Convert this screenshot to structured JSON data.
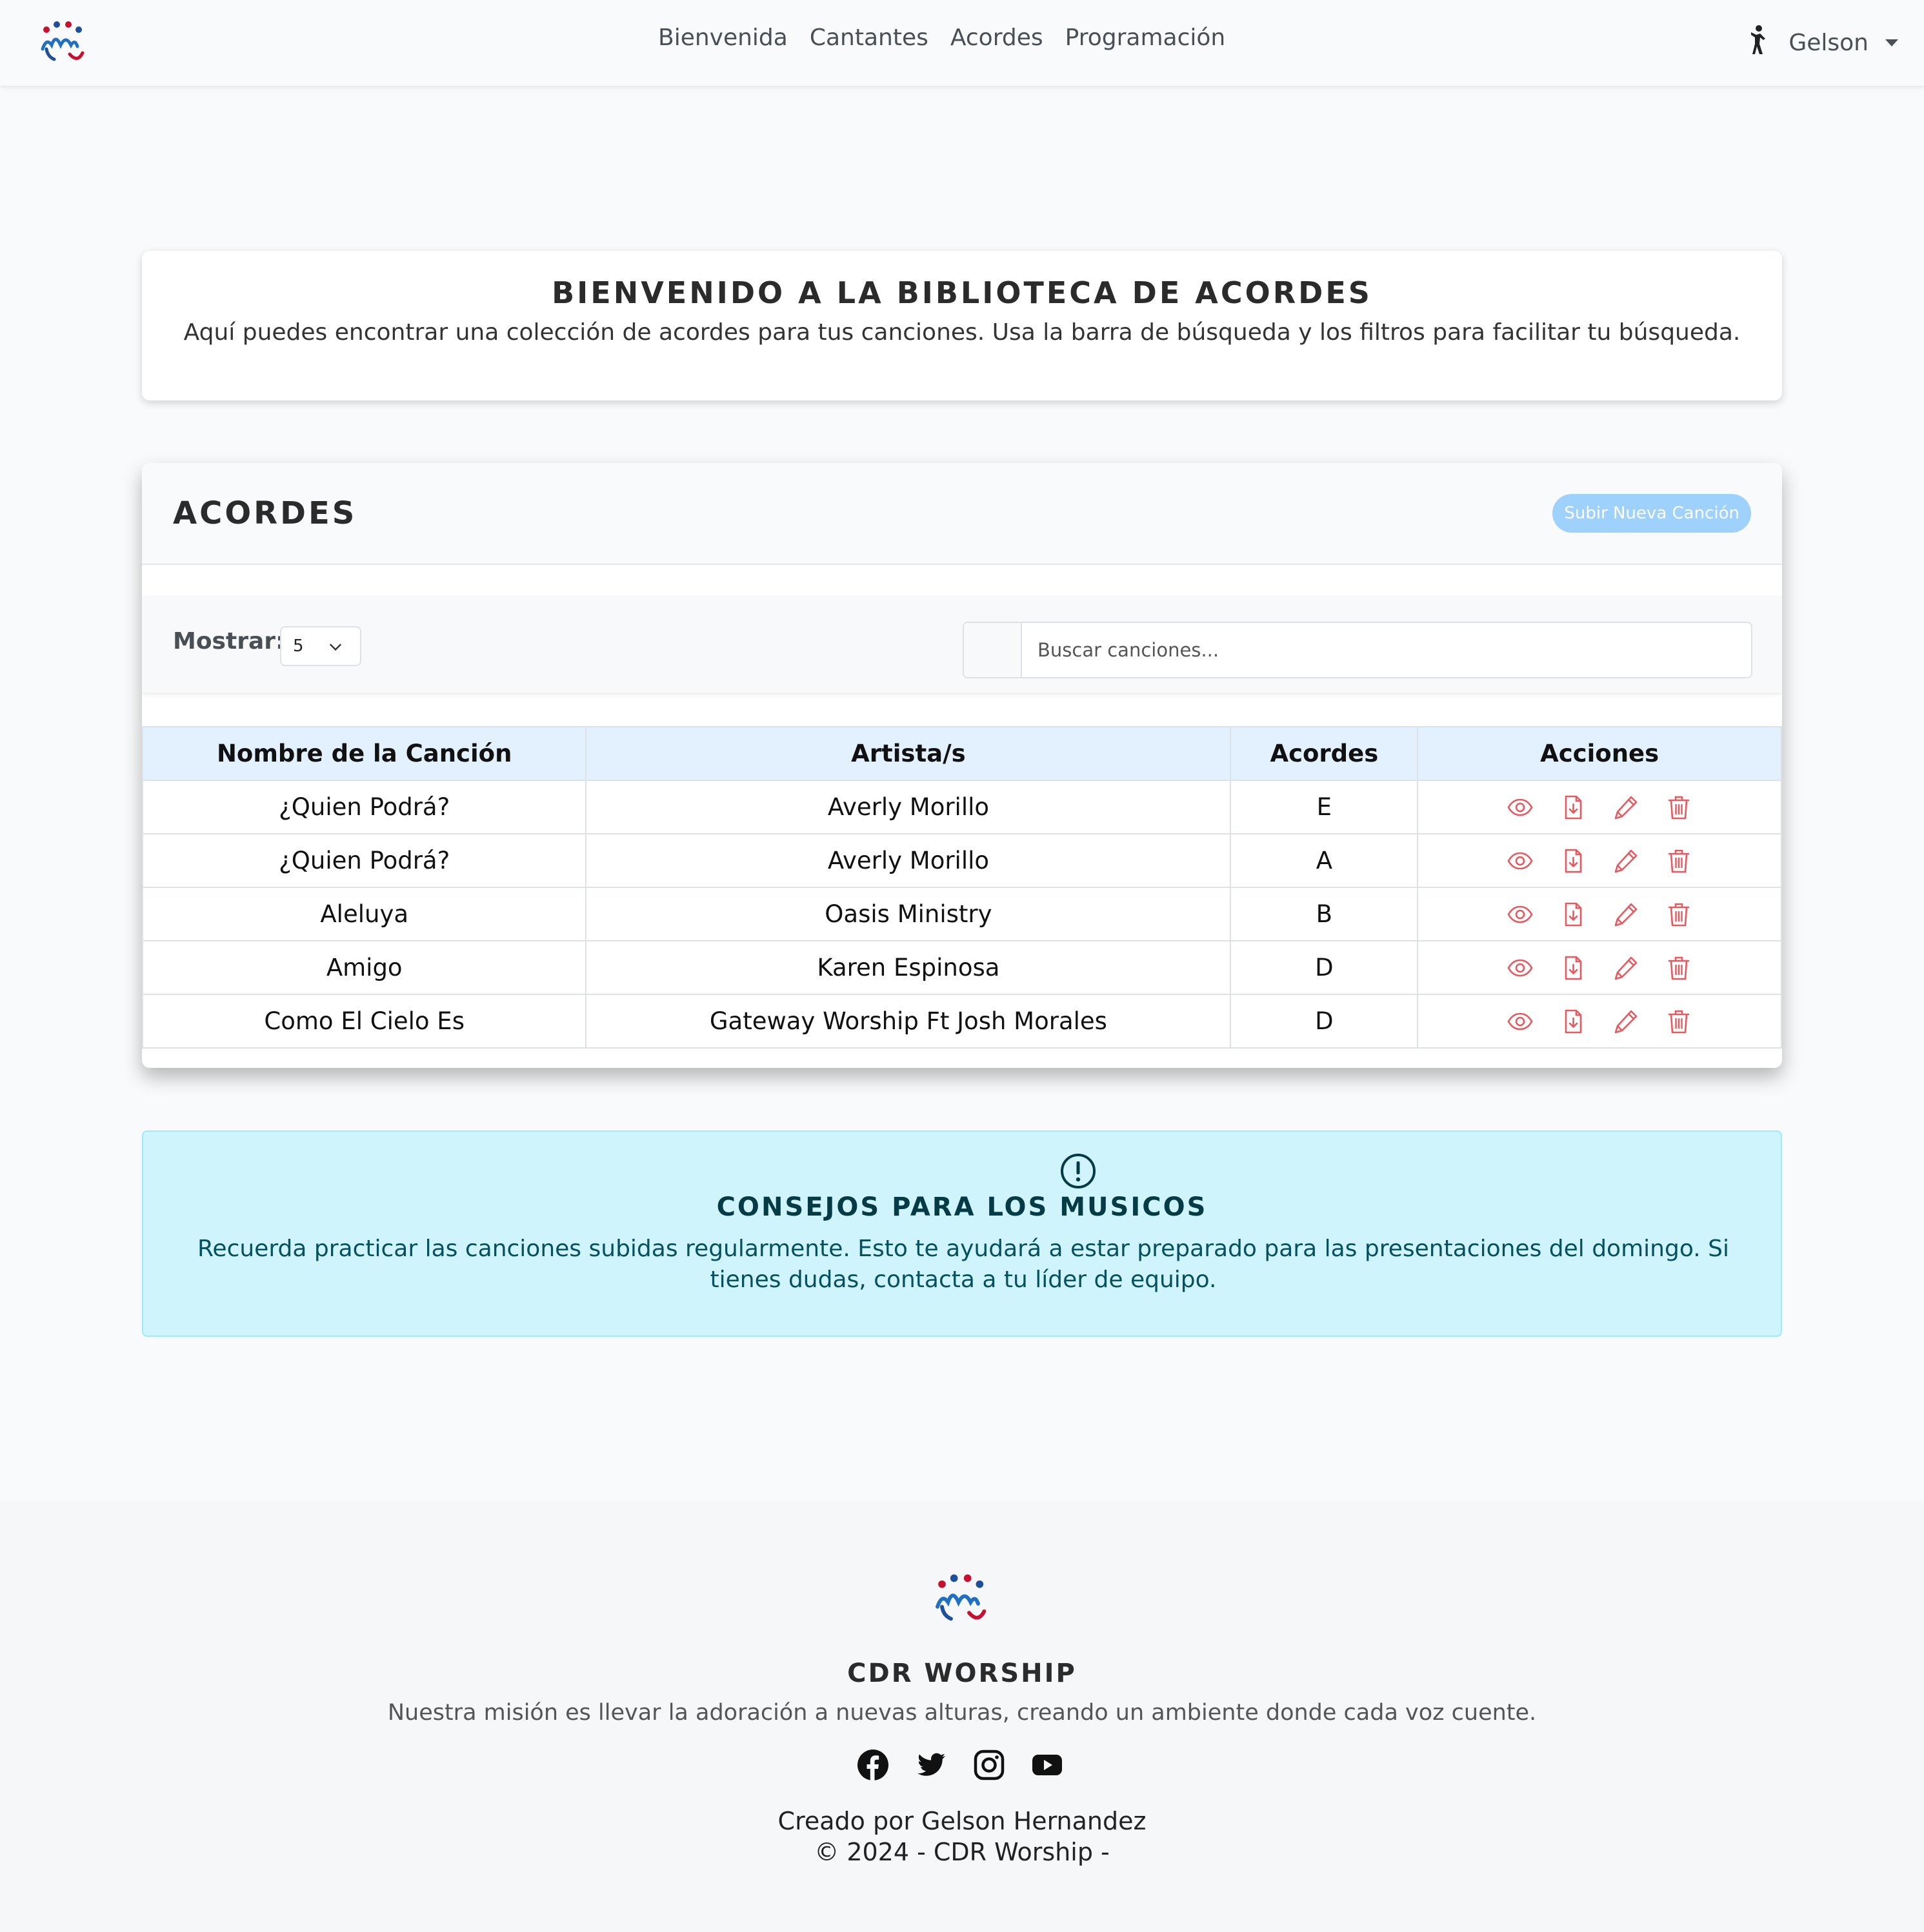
{
  "nav": {
    "links": [
      "Bienvenida",
      "Cantantes",
      "Acordes",
      "Programación"
    ],
    "user": "Gelson"
  },
  "welcome": {
    "title": "BIENVENIDO A LA BIBLIOTECA DE ACORDES",
    "text": "Aquí puedes encontrar una colección de acordes para tus canciones. Usa la barra de búsqueda y los filtros para facilitar tu búsqueda."
  },
  "chords": {
    "title": "ACORDES",
    "upload_label": "Subir Nueva Canción",
    "show_label": "Mostrar:",
    "show_value": "5",
    "search_placeholder": "Buscar canciones...",
    "columns": [
      "Nombre de la Canción",
      "Artista/s",
      "Acordes",
      "Acciones"
    ],
    "rows": [
      {
        "name": "¿Quien Podrá?",
        "artist": "Averly Morillo",
        "chord": "E"
      },
      {
        "name": "¿Quien Podrá?",
        "artist": "Averly Morillo",
        "chord": "A"
      },
      {
        "name": "Aleluya",
        "artist": "Oasis Ministry",
        "chord": "B"
      },
      {
        "name": "Amigo",
        "artist": "Karen Espinosa",
        "chord": "D"
      },
      {
        "name": "Como El Cielo Es",
        "artist": "Gateway Worship Ft Josh Morales",
        "chord": "D"
      }
    ],
    "action_icons": [
      "eye-icon",
      "file-download-icon",
      "pencil-icon",
      "trash-icon"
    ]
  },
  "tips": {
    "title": "CONSEJOS PARA LOS MUSICOS",
    "text": "Recuerda practicar las canciones subidas regularmente. Esto te ayudará a estar preparado para las presentaciones del domingo. Si tienes dudas, contacta a tu líder de equipo."
  },
  "footer": {
    "title": "CDR WORSHIP",
    "mission": "Nuestra misión es llevar la adoración a nuevas alturas, creando un ambiente donde cada voz cuente.",
    "socials": [
      "facebook-icon",
      "twitter-icon",
      "instagram-icon",
      "youtube-icon"
    ],
    "credit": "Creado por Gelson Hernandez",
    "copyright": "© 2024 - CDR Worship -"
  },
  "colors": {
    "action_red": "#e9585d",
    "upload_button": "#9ed1fb",
    "table_header": "#e2f1fd",
    "tips_background": "#cff4fc",
    "tips_text": "#055160"
  }
}
